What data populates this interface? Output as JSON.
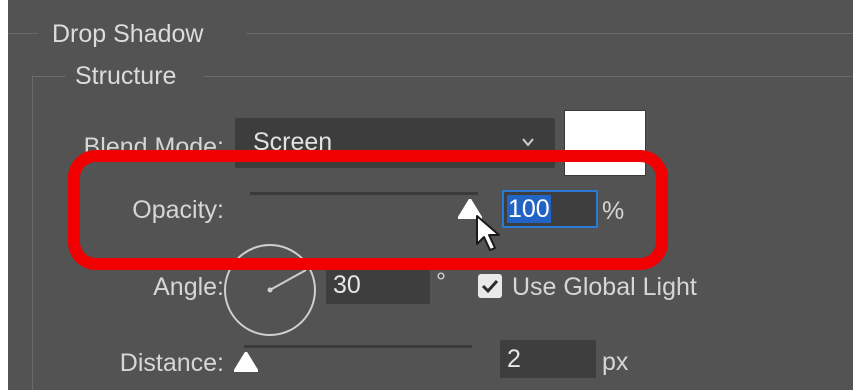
{
  "drop_shadow": {
    "title": "Drop Shadow",
    "structure": {
      "title": "Structure",
      "blend_mode": {
        "label": "Blend Mode:",
        "value": "Screen",
        "swatch_color": "#ffffff"
      },
      "opacity": {
        "label": "Opacity:",
        "value": "100",
        "unit": "%",
        "slider_level": 1.0
      },
      "angle": {
        "label": "Angle:",
        "value": "30",
        "unit": "°",
        "use_global_light_label": "Use Global Light",
        "use_global_light_checked": true
      },
      "distance": {
        "label": "Distance:",
        "value": "2",
        "unit": "px",
        "slider_level": 0.0
      }
    }
  },
  "annotation": {
    "highlight_color": "#f00000"
  },
  "icons": [
    "chevron-down-icon",
    "slider-knob-icon",
    "angle-dial-icon",
    "checkmark-icon",
    "mouse-pointer-icon"
  ]
}
